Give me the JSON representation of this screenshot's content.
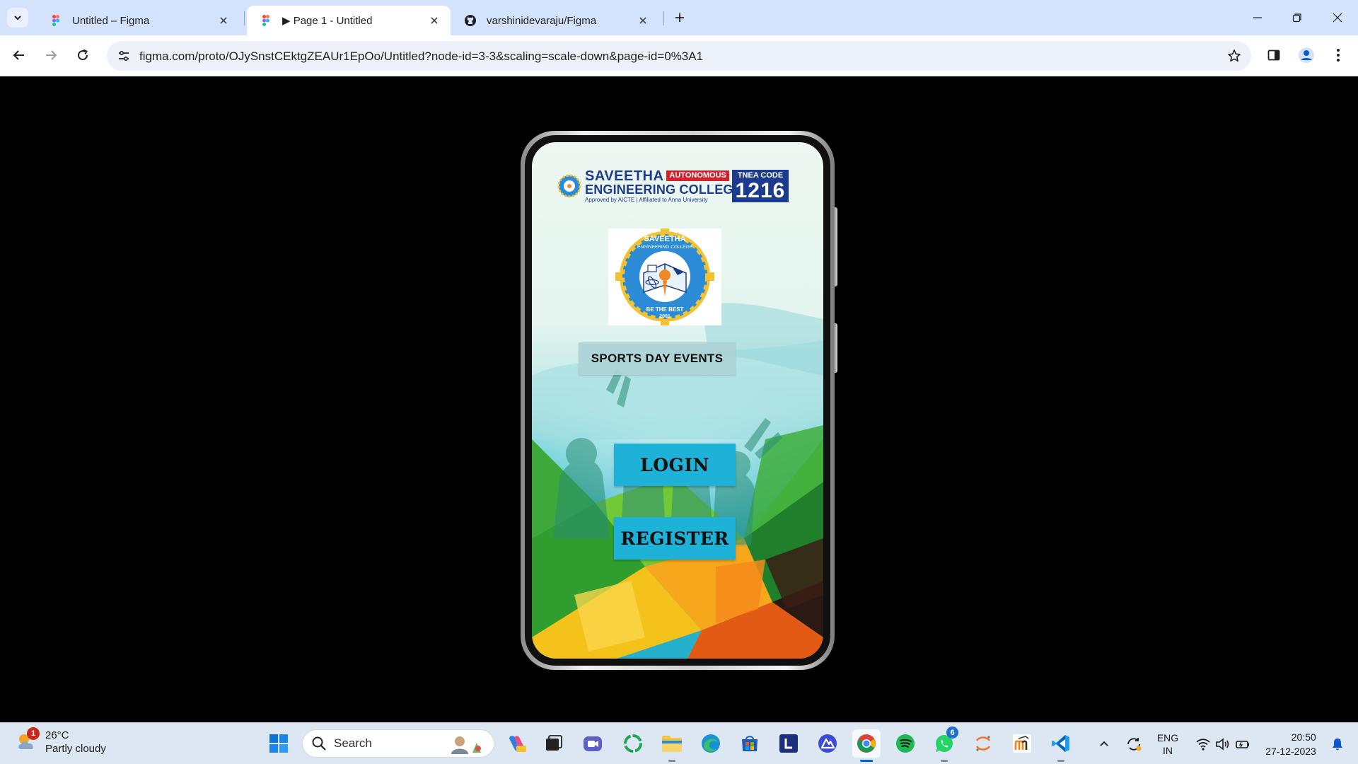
{
  "browser": {
    "tabs": [
      {
        "title": "Untitled – Figma",
        "favicon": "figma-icon",
        "active": false
      },
      {
        "title": "▶ Page 1 - Untitled",
        "favicon": "figma-icon",
        "active": true
      },
      {
        "title": "varshinidevaraju/Figma",
        "favicon": "github-icon",
        "active": false
      }
    ],
    "url": "figma.com/proto/OJySnstCEktgZEAUr1EpOo/Untitled?node-id=3-3&scaling=scale-down&page-id=0%3A1"
  },
  "app": {
    "college_logo": {
      "name_line1": "SAVEETHA",
      "badge": "AUTONOMOUS",
      "name_line2": "ENGINEERING COLLEGE",
      "approval": "Approved by AICTE | Affiliated to Anna University",
      "tnea_label": "TNEA CODE",
      "tnea_code": "1216"
    },
    "emblem": {
      "top_text": "SAVEETHA",
      "sub_text": "ENGINEERING COLLEGE",
      "motto": "BE THE BEST",
      "year": "2001"
    },
    "heading": "SPORTS DAY EVENTS",
    "login_label": "LOGIN",
    "register_label": "REGISTER"
  },
  "taskbar": {
    "weather": {
      "temp": "26°C",
      "desc": "Partly cloudy",
      "alert_count": "1"
    },
    "search_label": "Search",
    "whatsapp_badge": "6",
    "language": {
      "line1": "ENG",
      "line2": "IN"
    },
    "clock": {
      "time": "20:50",
      "date": "27-12-2023"
    }
  },
  "colors": {
    "tab_strip": "#d3e3fd",
    "omnibox": "#edf2fa",
    "button_blue": "#1fb2d8",
    "college_blue": "#1d3b8e",
    "college_red": "#d4222c",
    "taskbar": "#dde7f3"
  }
}
